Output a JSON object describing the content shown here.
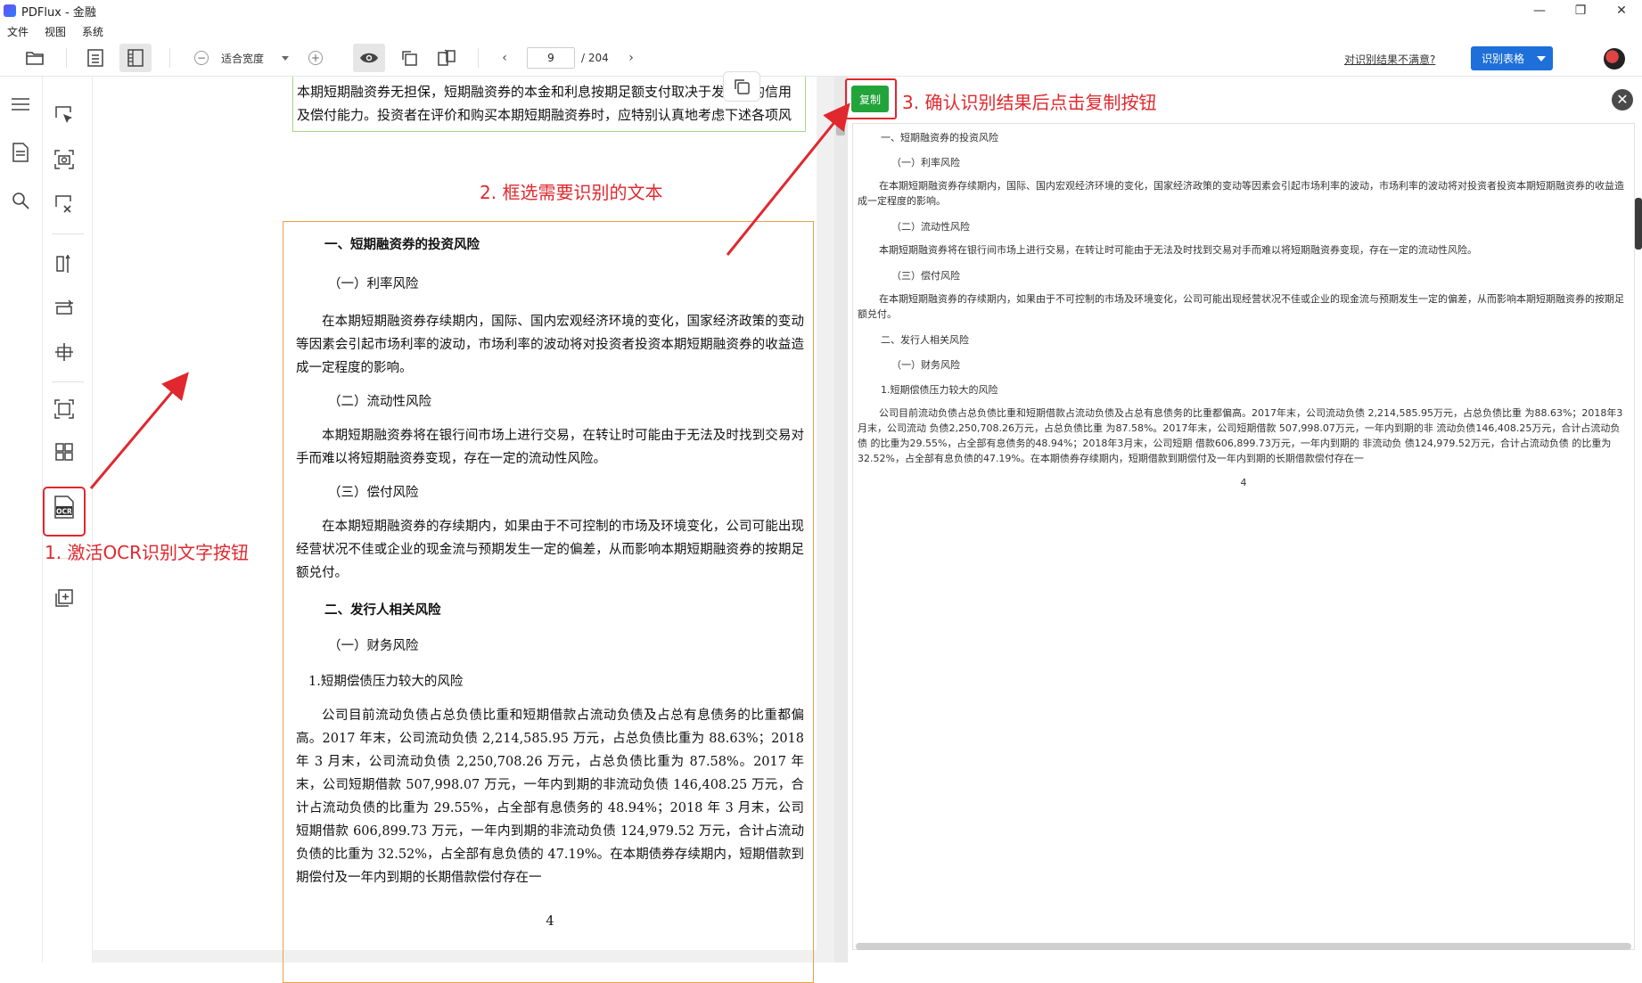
{
  "window": {
    "title": "PDFlux - 金融",
    "controls": {
      "minimize": "—",
      "maximize": "❐",
      "close": "✕"
    }
  },
  "menu": [
    "文件",
    "视图",
    "系统"
  ],
  "toolbar": {
    "zoom_label": "适合宽度",
    "page_current": "9",
    "page_total": "/ 204",
    "unsatisfied_link": "对识别结果不满意?",
    "recognize_table_label": "识别表格"
  },
  "document": {
    "prev_text": "本期短期融资券无担保，短期融资券的本金和利息按期足额支付取决于发行人的信用及偿付能力。投资者在评价和购买本期短期融资券时，应特别认真地考虑下述各项风险因素：",
    "heading1": "一、短期融资券的投资风险",
    "sub1": "（一）利率风险",
    "para1": "在本期短期融资券存续期内，国际、国内宏观经济环境的变化，国家经济政策的变动等因素会引起市场利率的波动，市场利率的波动将对投资者投资本期短期融资券的收益造成一定程度的影响。",
    "sub2": "（二）流动性风险",
    "para2": "本期短期融资券将在银行间市场上进行交易，在转让时可能由于无法及时找到交易对手而难以将短期融资券变现，存在一定的流动性风险。",
    "sub3": "（三）偿付风险",
    "para3": "在本期短期融资券的存续期内，如果由于不可控制的市场及环境变化，公司可能出现经营状况不佳或企业的现金流与预期发生一定的偏差，从而影响本期短期融资券的按期足额兑付。",
    "heading2": "二、发行人相关风险",
    "sub4": "（一）财务风险",
    "sub5": "1.短期偿债压力较大的风险",
    "para4": "公司目前流动负债占总负债比重和短期借款占流动负债及占总有息债务的比重都偏高。2017 年末，公司流动负债 2,214,585.95 万元，占总负债比重为 88.63%；2018 年 3 月末，公司流动负债 2,250,708.26 万元，占总负债比重为 87.58%。2017 年末，公司短期借款 507,998.07 万元，一年内到期的非流动负债 146,408.25 万元，合计占流动负债的比重为 29.55%，占全部有息债务的 48.94%；2018 年 3 月末，公司短期借款 606,899.73 万元，一年内到期的非流动负债 124,979.52 万元，合计占流动负债的比重为 32.52%，占全部有息负债的 47.19%。在本期债券存续期内，短期借款到期偿付及一年内到期的长期借款偿付存在一",
    "page_number": "4"
  },
  "result": {
    "copy_label": "复制",
    "close_label": "✕",
    "h1": "一、短期融资券的投资风险",
    "s1": "（一）利率风险",
    "p1": "在本期短期融资券存续期内，国际、国内宏观经济环境的变化，国家经济政策的变动等因素会引起市场利率的波动，市场利率的波动将对投资者投资本期短期融资券的收益造成一定程度的影响。",
    "s2": "（二）流动性风险",
    "p2": "本期短期融资券将在银行间市场上进行交易，在转让时可能由于无法及时找到交易对手而难以将短期融资券变现，存在一定的流动性风险。",
    "s3": "（三）偿付风险",
    "p3": "在本期短期融资券的存续期内，如果由于不可控制的市场及环境变化，公司可能出现经营状况不佳或企业的现金流与预期发生一定的偏差，从而影响本期短期融资券的按期足额兑付。",
    "h2": "二、发行人相关风险",
    "s4": "（一）财务风险",
    "s5": "1.短期偿债压力较大的风险",
    "p4": "公司目前流动负债占总负债比重和短期借款占流动负债及占总有息债务的比重都偏高。2017年末，公司流动负债 2,214,585.95万元，占总负债比重 为88.63%；2018年3月末，公司流动 负债2,250,708.26万元，占总负债比重 为87.58%。2017年末，公司短期借款 507,998.07万元，一年内到期的非 流动负债146,408.25万元，合计占流动负债 的比重为29.55%，占全部有息债务的48.94%；2018年3月末，公司短期 借款606,899.73万元，一年内到期的 非流动负 债124,979.52万元，合计占流动负债 的比重为32.52%，占全部有息负债的47.19%。在本期债券存续期内，短期借款到期偿付及一年内到期的长期借款偿付存在一",
    "page_number": "4"
  },
  "annotations": {
    "step1": "1. 激活OCR识别文字按钮",
    "step2": "2. 框选需要识别的文本",
    "step3": "3. 确认识别结果后点击复制按钮",
    "color": "#e0282e"
  },
  "colors": {
    "accent_blue": "#1e6fd9",
    "copy_green": "#22a43a",
    "selection_border": "#e8a04a"
  }
}
